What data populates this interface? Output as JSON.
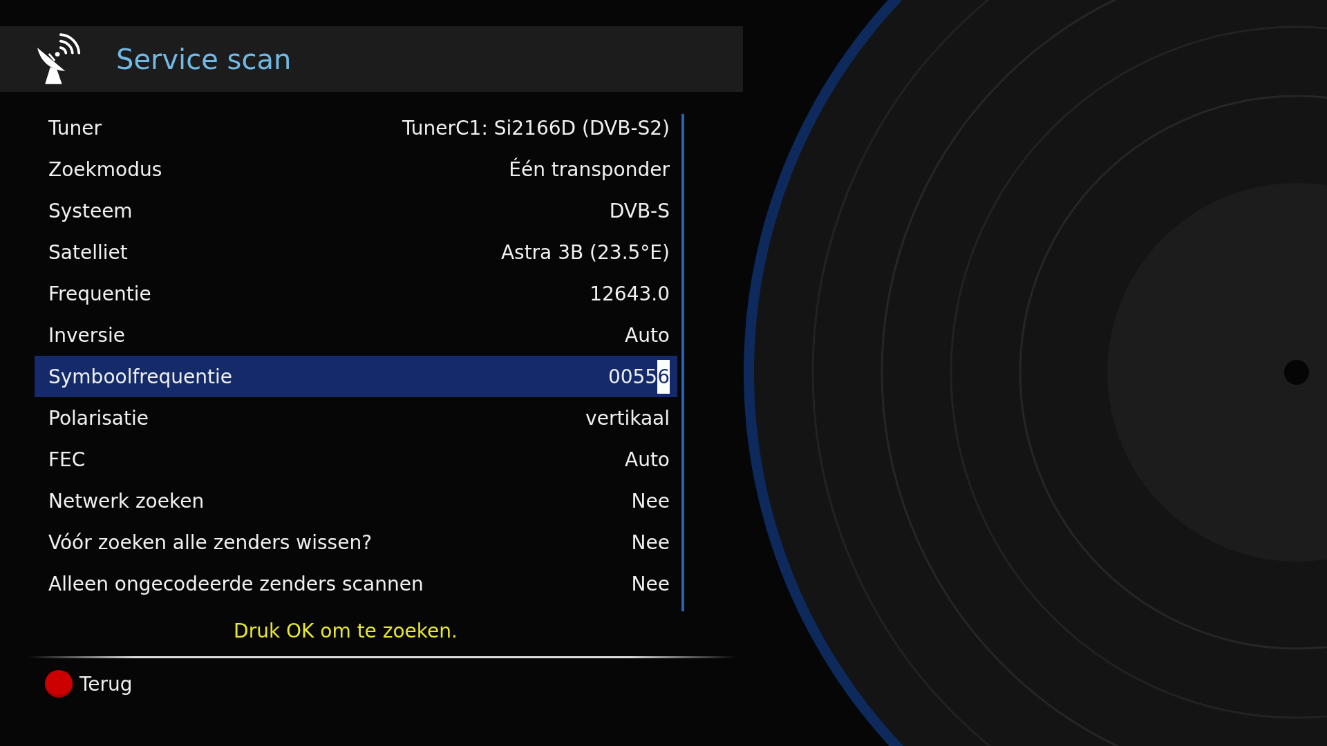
{
  "header": {
    "title": "Service scan"
  },
  "settings": [
    {
      "label": "Tuner",
      "value": "TunerC1: Si2166D (DVB-S2)",
      "selected": false
    },
    {
      "label": "Zoekmodus",
      "value": "Één transponder",
      "selected": false
    },
    {
      "label": "Systeem",
      "value": "DVB-S",
      "selected": false
    },
    {
      "label": "Satelliet",
      "value": "Astra 3B (23.5°E)",
      "selected": false
    },
    {
      "label": "Frequentie",
      "value": "12643.0",
      "selected": false
    },
    {
      "label": "Inversie",
      "value": "Auto",
      "selected": false
    },
    {
      "label": "Symboolfrequentie",
      "value": "00556",
      "selected": true,
      "cursor_on_last": true
    },
    {
      "label": "Polarisatie",
      "value": "vertikaal",
      "selected": false
    },
    {
      "label": "FEC",
      "value": "Auto",
      "selected": false
    },
    {
      "label": "Netwerk zoeken",
      "value": "Nee",
      "selected": false
    },
    {
      "label": "Vóór zoeken alle zenders wissen?",
      "value": "Nee",
      "selected": false
    },
    {
      "label": "Alleen ongecodeerde zenders scannen",
      "value": "Nee",
      "selected": false
    }
  ],
  "hint": "Druk OK om te zoeken.",
  "buttons": [
    {
      "label": "Terug",
      "color": "#cc0000"
    }
  ]
}
